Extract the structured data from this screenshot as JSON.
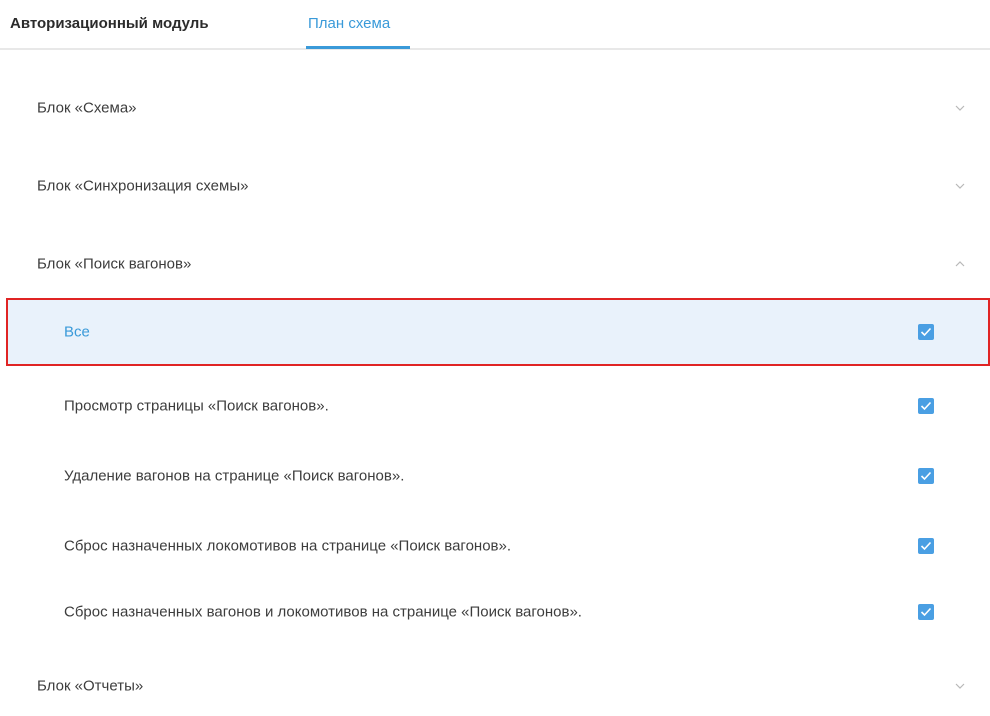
{
  "tabs": [
    {
      "label": "Авторизационный модуль",
      "active": false
    },
    {
      "label": "План схема",
      "active": true
    }
  ],
  "accent_color": "#3a9ad9",
  "checkbox_color": "#4a9fe3",
  "highlight_border_color": "#e02424",
  "sections": {
    "schema": {
      "label": "Блок «Схема»",
      "expanded": false,
      "icon": "chevron-down-icon"
    },
    "sync": {
      "label": "Блок «Синхронизация схемы»",
      "expanded": false,
      "icon": "chevron-down-icon"
    },
    "search": {
      "label": "Блок «Поиск вагонов»",
      "expanded": true,
      "icon": "chevron-up-icon",
      "items": [
        {
          "label": "Все",
          "checked": true,
          "selected": true
        },
        {
          "label": "Просмотр страницы «Поиск вагонов».",
          "checked": true
        },
        {
          "label": "Удаление вагонов на странице «Поиск вагонов».",
          "checked": true
        },
        {
          "label": "Сброс назначенных локомотивов на странице «Поиск вагонов».",
          "checked": true
        },
        {
          "label": "Сброс назначенных вагонов и локомотивов на странице «Поиск вагонов».",
          "checked": true
        }
      ]
    },
    "reports": {
      "label": "Блок «Отчеты»",
      "expanded": false,
      "icon": "chevron-down-icon"
    }
  }
}
